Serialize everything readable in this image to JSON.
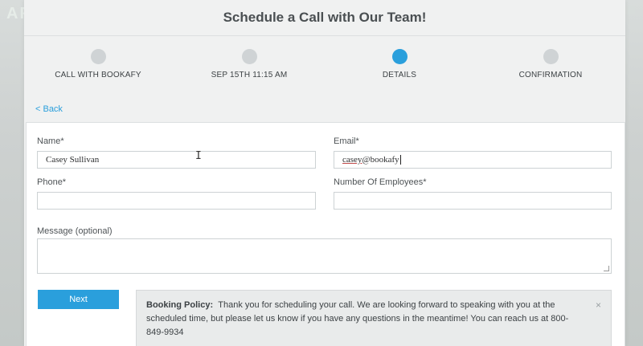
{
  "background": {
    "logo_text": "AFY"
  },
  "header": {
    "title": "Schedule a Call with Our Team!"
  },
  "steps": [
    {
      "label": "CALL WITH BOOKAFY",
      "state": "done"
    },
    {
      "label": "SEP 15TH 11:15 AM",
      "state": "done"
    },
    {
      "label": "DETAILS",
      "state": "active"
    },
    {
      "label": "CONFIRMATION",
      "state": "pending"
    }
  ],
  "nav": {
    "back_label": "< Back"
  },
  "form": {
    "name_label": "Name*",
    "name_value": "Casey Sullivan",
    "email_label": "Email*",
    "email_value_underlined": "casey",
    "email_value_rest": "@bookafy",
    "phone_label": "Phone*",
    "phone_value": "",
    "employees_label": "Number Of Employees*",
    "employees_value": "",
    "message_label": "Message (optional)",
    "message_value": "",
    "next_label": "Next"
  },
  "policy": {
    "title": "Booking Policy:",
    "text": "Thank you for scheduling your call. We are looking forward to speaking with you at the scheduled time, but please let us know if you have any questions in the meantime! You can reach us at 800-849-9934",
    "close_glyph": "×"
  },
  "colors": {
    "accent": "#2a9fdc",
    "inactive_dot": "#cfd3d5",
    "header_text": "#4a4f52"
  }
}
